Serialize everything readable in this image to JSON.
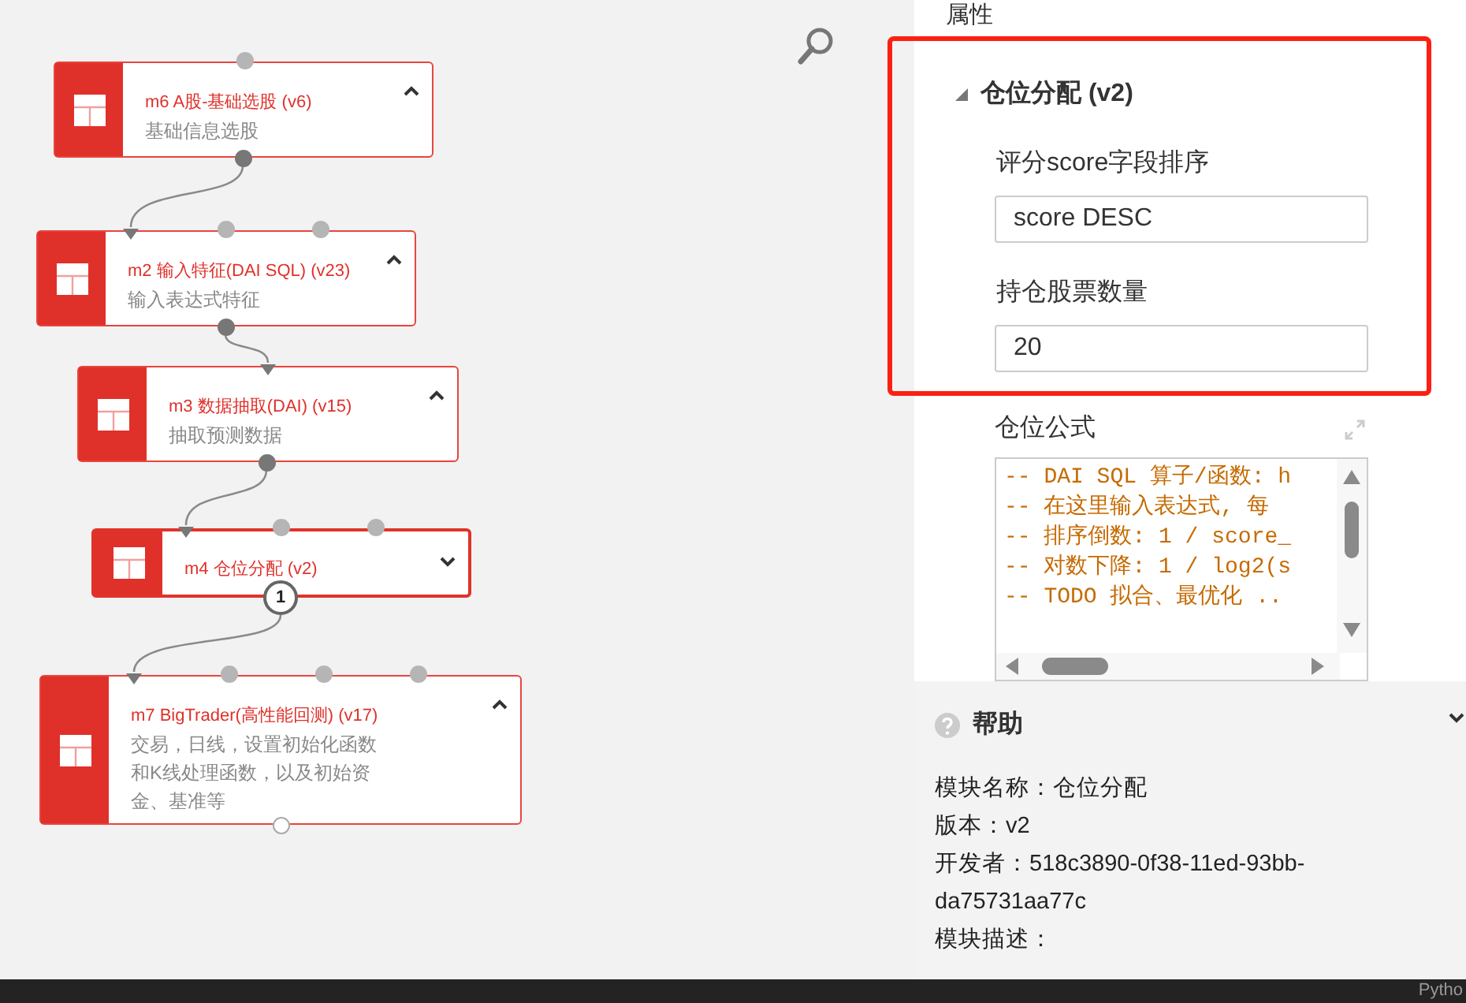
{
  "canvas": {
    "nodes": [
      {
        "title": "m6 A股-基础选股 (v6)",
        "description": "基础信息选股",
        "expanded": true,
        "selected": false,
        "inputs": [
          {
            "connected": false
          }
        ],
        "outputs": [
          {
            "connected": true
          }
        ]
      },
      {
        "title": "m2 输入特征(DAI SQL) (v23)",
        "description": "输入表达式特征",
        "expanded": true,
        "selected": false,
        "inputs": [
          {
            "connected": true
          },
          {
            "connected": false
          },
          {
            "connected": false
          }
        ],
        "outputs": [
          {
            "connected": true
          }
        ]
      },
      {
        "title": "m3 数据抽取(DAI) (v15)",
        "description": "抽取预测数据",
        "expanded": true,
        "selected": false,
        "inputs": [
          {
            "connected": true
          }
        ],
        "outputs": [
          {
            "connected": true
          }
        ]
      },
      {
        "title": "m4 仓位分配 (v2)",
        "expanded": false,
        "selected": true,
        "inputs": [
          {
            "connected": true
          },
          {
            "connected": false
          },
          {
            "connected": false
          }
        ],
        "outputs": [
          {
            "label": "1"
          }
        ]
      },
      {
        "title": "m7 BigTrader(高性能回测) (v17)",
        "description": "交易，日线，设置初始化函数和K线处理函数，以及初始资金、基准等",
        "expanded": true,
        "selected": false,
        "inputs": [
          {
            "connected": true
          },
          {
            "connected": false
          },
          {
            "connected": false
          },
          {
            "connected": false
          }
        ],
        "outputs": [
          {
            "connected": false
          }
        ]
      }
    ]
  },
  "properties": {
    "title": "属性",
    "section": {
      "title": "仓位分配 (v2)",
      "expanded": true,
      "fields": [
        {
          "label": "评分score字段排序",
          "value": "score DESC"
        },
        {
          "label": "持仓股票数量",
          "value": "20"
        }
      ]
    },
    "formula": {
      "label": "仓位公式",
      "lines": [
        "-- DAI SQL 算子/函数: h",
        "-- 在这里输入表达式, 每",
        "-- 排序倒数: 1 / score_",
        "-- 对数下降: 1 / log2(s",
        "-- TODO 拟合、最优化 .."
      ]
    }
  },
  "help": {
    "title": "帮助",
    "expanded": true,
    "lines": [
      "模块名称：仓位分配",
      "版本：v2",
      "开发者：518c3890-0f38-11ed-93bb-da75731aa77c",
      "模块描述："
    ]
  },
  "status_bar": {
    "text": "Pytho"
  }
}
